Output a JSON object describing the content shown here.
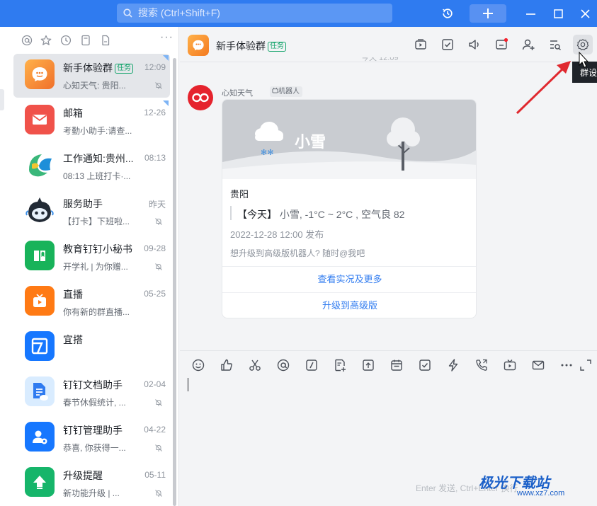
{
  "topbar": {
    "search_placeholder": "搜索 (Ctrl+Shift+F)",
    "icons": [
      "history-icon",
      "plus-icon",
      "minimize-icon",
      "maximize-icon",
      "close-icon"
    ]
  },
  "sidebar": {
    "filter_icons": [
      "at-icon",
      "star-icon",
      "clock-icon",
      "doc-icon",
      "file-icon"
    ],
    "more_label": "···",
    "conversations": [
      {
        "title": "新手体验群",
        "tag": "任务",
        "subtitle": "心知天气: 贵阳...",
        "time": "12:09",
        "muted": true,
        "active": true,
        "avatar": "group"
      },
      {
        "title": "邮箱",
        "tag": "",
        "subtitle": "考勤小助手:请查...",
        "time": "12-26",
        "muted": false,
        "active": false,
        "avatar": "mail"
      },
      {
        "title": "工作通知:贵州...",
        "tag": "",
        "subtitle": "08:13 上班打卡·...",
        "time": "08:13",
        "muted": false,
        "active": false,
        "avatar": "work"
      },
      {
        "title": "服务助手",
        "tag": "",
        "subtitle": "【打卡】下班啦...",
        "time": "昨天",
        "muted": true,
        "active": false,
        "avatar": "bot"
      },
      {
        "title": "教育钉钉小秘书",
        "tag": "",
        "subtitle": "开学礼 | 为你赠...",
        "time": "09-28",
        "muted": true,
        "active": false,
        "avatar": "edu"
      },
      {
        "title": "直播",
        "tag": "",
        "subtitle": "你有新的群直播...",
        "time": "05-25",
        "muted": false,
        "active": false,
        "avatar": "live"
      },
      {
        "title": "宜搭",
        "tag": "",
        "subtitle": "",
        "time": "",
        "muted": false,
        "active": false,
        "avatar": "yida"
      },
      {
        "title": "钉钉文档助手",
        "tag": "",
        "subtitle": "春节休假统计, ...",
        "time": "02-04",
        "muted": true,
        "active": false,
        "avatar": "docs"
      },
      {
        "title": "钉钉管理助手",
        "tag": "",
        "subtitle": "恭喜, 你获得一...",
        "time": "04-22",
        "muted": true,
        "active": false,
        "avatar": "admin"
      },
      {
        "title": "升级提醒",
        "tag": "",
        "subtitle": "新功能升级 | ...",
        "time": "05-11",
        "muted": true,
        "active": false,
        "avatar": "upgrade"
      }
    ]
  },
  "chat": {
    "title": "新手体验群",
    "tag": "任务",
    "header_icons": [
      "screen-icon",
      "task-icon",
      "speaker-icon",
      "inbox-icon",
      "add-member-icon",
      "search-history-icon",
      "gear-icon"
    ],
    "tooltip": "群设",
    "prev_time": "今天 12:09",
    "message": {
      "sender": "心知天气",
      "robot_tag": "机器人",
      "card": {
        "weather": "小雪",
        "city": "贵阳",
        "today_label": "【今天】",
        "today_detail": "小雪, -1°C ~ 2°C , 空气良 82",
        "published": "2022-12-28 12:00 发布",
        "upgrade_hint": "想升级到高级版机器人? 随时@我吧",
        "button1": "查看实况及更多",
        "button2": "升级到高级版"
      }
    },
    "toolbar_icons": [
      "emoji-icon",
      "like-icon",
      "scissors-icon",
      "at-icon",
      "slash-icon",
      "doc-add-icon",
      "upload-icon",
      "calendar-icon",
      "checkbox-icon",
      "lightning-icon",
      "phone-icon",
      "tv-icon",
      "mail-icon",
      "more-icon",
      "expand-icon"
    ],
    "send_hint": "Enter 发送, Ctrl+Enter 换行"
  },
  "watermark": {
    "title": "极光下载站",
    "url": "www.xz7.com"
  },
  "colors": {
    "brand": "#2f7bf0",
    "active_row": "#e4e6ea",
    "tag_green": "#12a36a",
    "arrow_red": "#e0292f"
  }
}
